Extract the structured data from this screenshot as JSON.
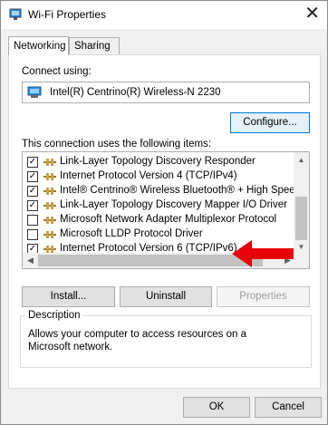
{
  "window": {
    "title": "Wi-Fi Properties",
    "close_glyph": "✕"
  },
  "tabs": [
    {
      "label": "Networking",
      "active": true
    },
    {
      "label": "Sharing",
      "active": false
    }
  ],
  "connect": {
    "label": "Connect using:",
    "adapter": "Intel(R) Centrino(R) Wireless-N 2230"
  },
  "buttons": {
    "configure": "Configure...",
    "install": "Install...",
    "uninstall": "Uninstall",
    "properties": "Properties",
    "ok": "OK",
    "cancel": "Cancel"
  },
  "items_label": "This connection uses the following items:",
  "items": [
    {
      "label": "Link-Layer Topology Discovery Responder",
      "checked": true
    },
    {
      "label": "Internet Protocol Version 4 (TCP/IPv4)",
      "checked": true
    },
    {
      "label": "Intel® Centrino® Wireless Bluetooth® + High Speed Pr",
      "checked": true
    },
    {
      "label": "Link-Layer Topology Discovery Mapper I/O Driver",
      "checked": true
    },
    {
      "label": "Microsoft Network Adapter Multiplexor Protocol",
      "checked": false
    },
    {
      "label": "Microsoft LLDP Protocol Driver",
      "checked": false
    },
    {
      "label": "Internet Protocol Version 6 (TCP/IPv6)",
      "checked": true
    }
  ],
  "description": {
    "legend": "Description",
    "text": "Allows your computer to access resources on a Microsoft network."
  },
  "colors": {
    "annotation_arrow": "#e8000b",
    "focus_border": "#0078d7"
  }
}
